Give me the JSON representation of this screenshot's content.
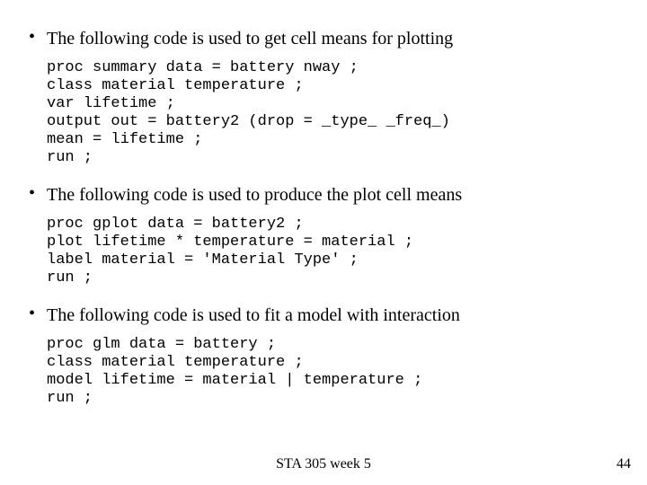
{
  "bullets": [
    {
      "text": "The following code is used to get cell means for plotting",
      "code": "proc summary data = battery nway ;\nclass material temperature ;\nvar lifetime ;\noutput out = battery2 (drop = _type_ _freq_)\nmean = lifetime ;\nrun ;"
    },
    {
      "text": "The following code is used to produce the plot cell means",
      "code": "proc gplot data = battery2 ;\nplot lifetime * temperature = material ;\nlabel material = 'Material Type' ;\nrun ;"
    },
    {
      "text": "The following code is used to fit a model with interaction",
      "code": "proc glm data = battery ;\nclass material temperature ;\nmodel lifetime = material | temperature ;\nrun ;"
    }
  ],
  "footer": {
    "center": "STA 305 week 5",
    "page_number": "44"
  }
}
